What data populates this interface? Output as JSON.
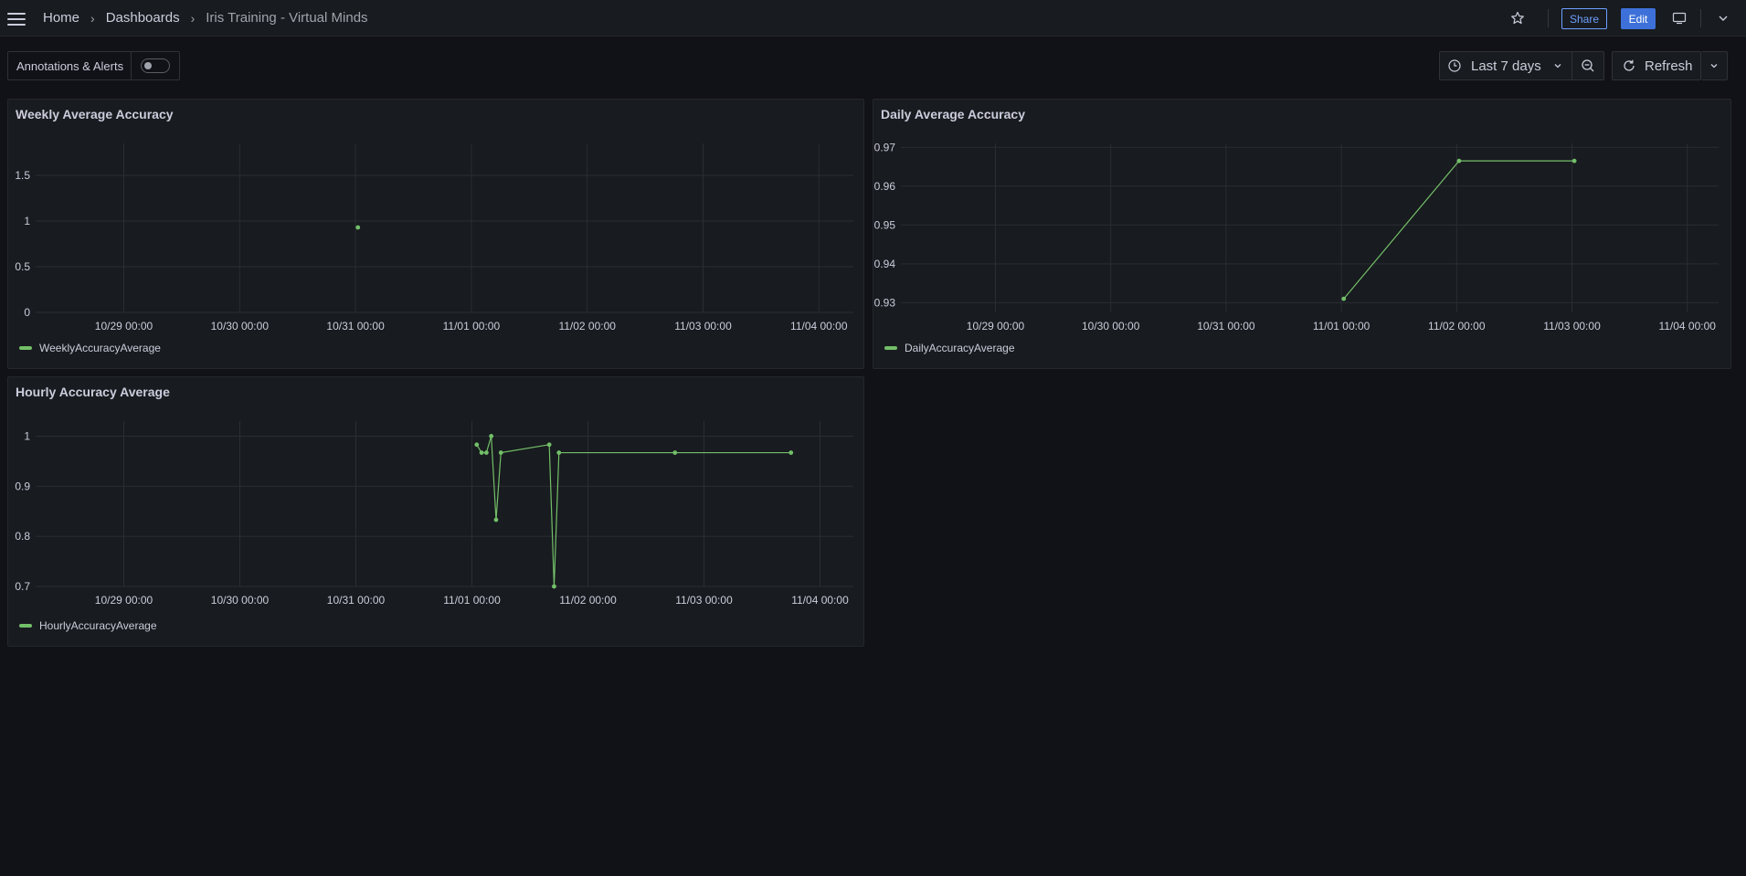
{
  "breadcrumb": [
    {
      "label": "Home"
    },
    {
      "label": "Dashboards"
    },
    {
      "label": "Iris Training - Virtual Minds"
    }
  ],
  "toolbar": {
    "share_label": "Share",
    "edit_label": "Edit",
    "icons": [
      "star-icon",
      "tv-icon",
      "chevron-down-icon"
    ]
  },
  "controls": {
    "annotations_label": "Annotations & Alerts",
    "annotations_enabled": false,
    "time_range_label": "Last 7 days",
    "refresh_label": "Refresh"
  },
  "colors": {
    "background": "#111217",
    "panel": "#181b1f",
    "series": "#73bf69",
    "accent": "#3d71d9"
  },
  "panels": {
    "weekly": {
      "title": "Weekly Average Accuracy",
      "legend": "WeeklyAccuracyAverage"
    },
    "daily": {
      "title": "Daily Average Accuracy",
      "legend": "DailyAccuracyAverage"
    },
    "hourly": {
      "title": "Hourly Accuracy Average",
      "legend": "HourlyAccuracyAverage"
    }
  },
  "chart_data": [
    {
      "type": "scatter",
      "title": "Weekly Average Accuracy",
      "x_ticks": [
        "10/29 00:00",
        "10/30 00:00",
        "10/31 00:00",
        "11/01 00:00",
        "11/02 00:00",
        "11/03 00:00",
        "11/04 00:00"
      ],
      "y_ticks": [
        0,
        0.5,
        1,
        1.5
      ],
      "ylim": [
        0,
        1.85
      ],
      "grid": true,
      "legend_position": "bottom-left",
      "series": [
        {
          "name": "WeeklyAccuracyAverage",
          "x": [
            "10/31 00:30"
          ],
          "y": [
            0.93
          ]
        }
      ]
    },
    {
      "type": "line",
      "title": "Daily Average Accuracy",
      "x_ticks": [
        "10/29 00:00",
        "10/30 00:00",
        "10/31 00:00",
        "11/01 00:00",
        "11/02 00:00",
        "11/03 00:00",
        "11/04 00:00"
      ],
      "y_ticks": [
        0.93,
        0.94,
        0.95,
        0.96,
        0.97
      ],
      "ylim": [
        0.9275,
        0.971
      ],
      "grid": true,
      "legend_position": "bottom-left",
      "series": [
        {
          "name": "DailyAccuracyAverage",
          "x": [
            "11/01 00:30",
            "11/02 00:30",
            "11/03 00:30"
          ],
          "y": [
            0.931,
            0.9665,
            0.9665
          ]
        }
      ]
    },
    {
      "type": "line",
      "title": "Hourly Accuracy Average",
      "x_ticks": [
        "10/29 00:00",
        "10/30 00:00",
        "10/31 00:00",
        "11/01 00:00",
        "11/02 00:00",
        "11/03 00:00",
        "11/04 00:00"
      ],
      "y_ticks": [
        0.7,
        0.8,
        0.9,
        1
      ],
      "ylim": [
        0.7,
        1.03
      ],
      "grid": true,
      "legend_position": "bottom-left",
      "series": [
        {
          "name": "HourlyAccuracyAverage",
          "x": [
            "11/01 01:00",
            "11/01 02:00",
            "11/01 03:00",
            "11/01 04:00",
            "11/01 05:00",
            "11/01 06:00",
            "11/01 16:00",
            "11/01 17:00",
            "11/01 18:00",
            "11/02 18:00",
            "11/03 18:00"
          ],
          "y": [
            0.983,
            0.967,
            0.967,
            1.0,
            0.833,
            0.967,
            0.983,
            0.7,
            0.967,
            0.967,
            0.967
          ]
        }
      ]
    }
  ]
}
